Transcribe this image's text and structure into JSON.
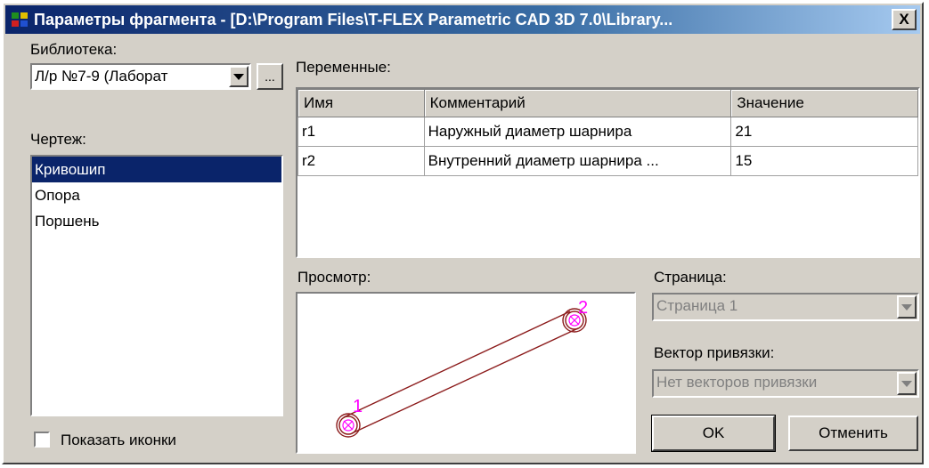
{
  "window": {
    "title": "Параметры фрагмента - [D:\\Program Files\\T-FLEX Parametric CAD 3D 7.0\\Library...",
    "close_glyph": "X"
  },
  "library": {
    "label": "Библиотека:",
    "selected": "Л/р №7-9 (Лаборат",
    "browse_label": "..."
  },
  "drawing": {
    "label": "Чертеж:",
    "items": [
      "Кривошип",
      "Опора",
      "Поршень"
    ],
    "selected_index": 0
  },
  "show_icons": {
    "label": "Показать иконки",
    "checked": false
  },
  "variables": {
    "label": "Переменные:",
    "columns": [
      "Имя",
      "Комментарий",
      "Значение"
    ],
    "rows": [
      [
        "r1",
        "Наружный диаметр шарнира",
        "21"
      ],
      [
        "r2",
        "Внутренний диаметр шарнира ...",
        "15"
      ]
    ]
  },
  "preview": {
    "label": "Просмотр:",
    "point_labels": [
      "1",
      "2"
    ],
    "line_color": "#8b1a1a",
    "marker_color": "#ff00ff"
  },
  "page": {
    "label": "Страница:",
    "value": "Страница 1"
  },
  "anchor_vector": {
    "label": "Вектор привязки:",
    "value": "Нет векторов привязки"
  },
  "buttons": {
    "ok": "OK",
    "cancel": "Отменить"
  }
}
